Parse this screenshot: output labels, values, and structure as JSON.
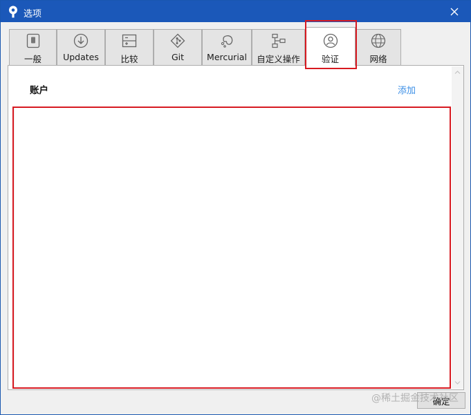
{
  "window": {
    "title": "选项",
    "close_icon": "close-icon"
  },
  "tabs": [
    {
      "label": "一般",
      "icon": "general-switch-icon"
    },
    {
      "label": "Updates",
      "icon": "download-circle-icon"
    },
    {
      "label": "比较",
      "icon": "diff-icon"
    },
    {
      "label": "Git",
      "icon": "git-icon"
    },
    {
      "label": "Mercurial",
      "icon": "mercurial-icon"
    },
    {
      "label": "自定义操作",
      "icon": "custom-actions-icon"
    },
    {
      "label": "验证",
      "icon": "user-circle-icon",
      "selected": true
    },
    {
      "label": "网络",
      "icon": "globe-icon"
    }
  ],
  "auth": {
    "accounts_title": "账户",
    "add_label": "添加",
    "accounts": []
  },
  "footer": {
    "ok_label": "确定"
  },
  "watermark": "@稀土掘金技术社区",
  "colors": {
    "titlebar": "#1b58b9",
    "link": "#3a8ee6",
    "highlight": "#d71920"
  }
}
